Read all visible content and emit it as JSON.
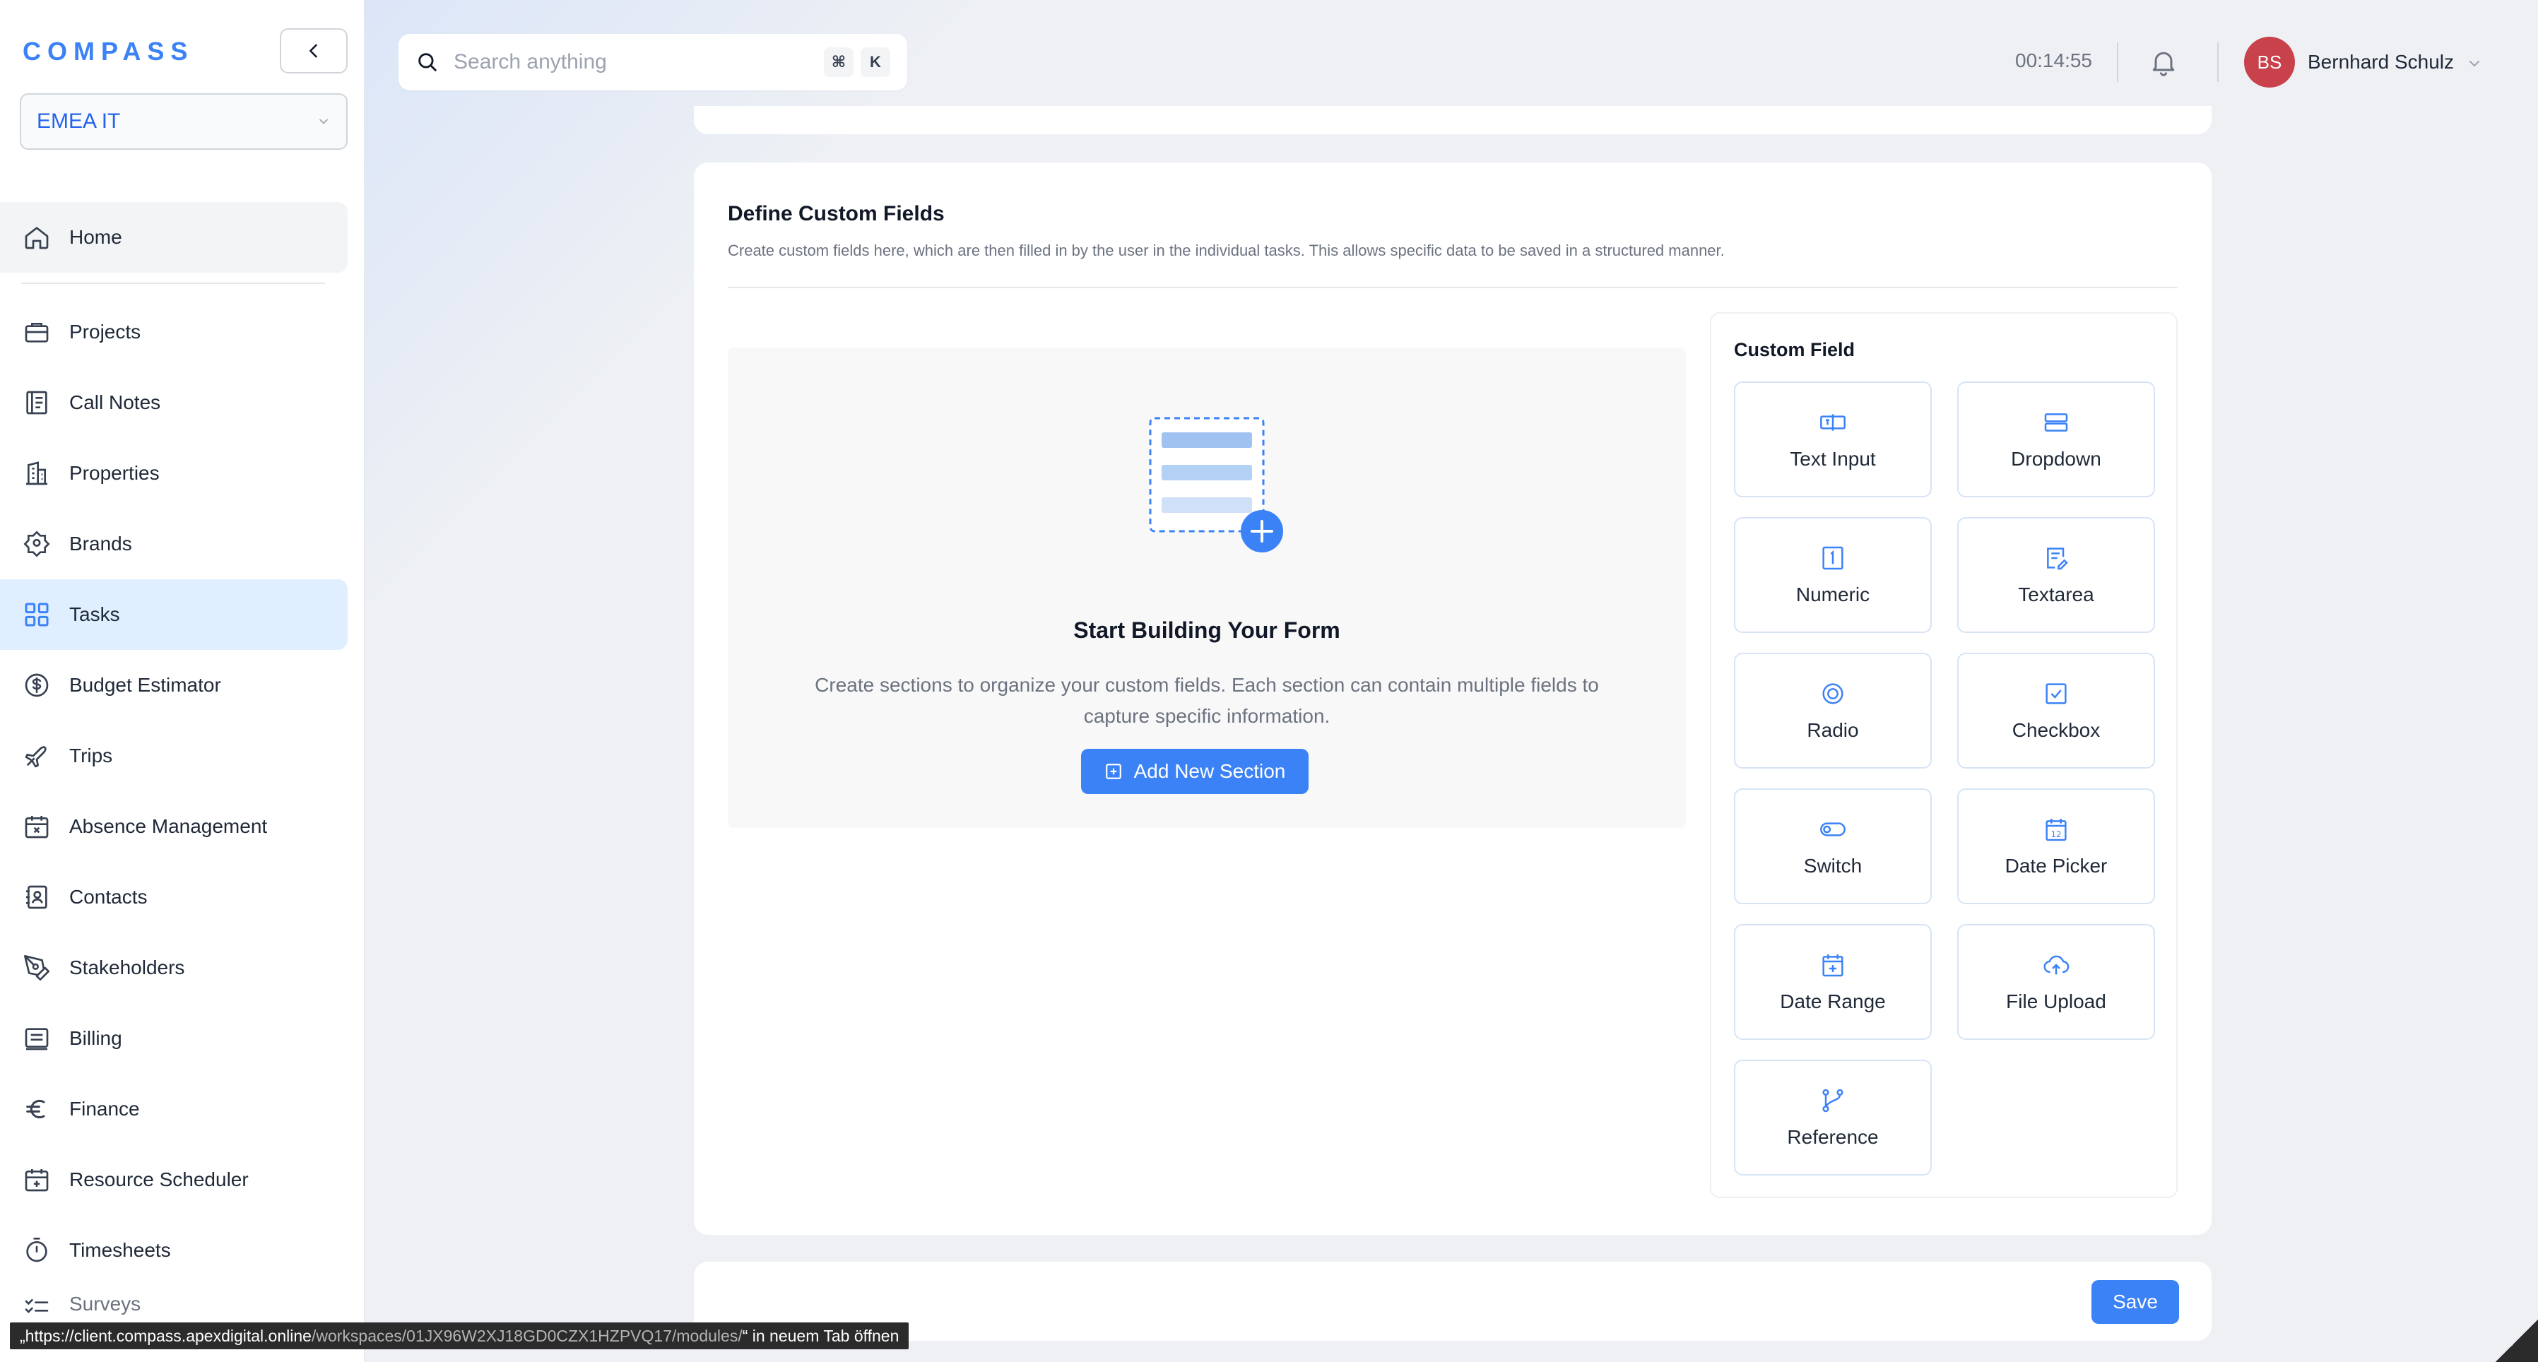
{
  "app": {
    "logo": "COMPASS"
  },
  "sidebar": {
    "org": "EMEA IT",
    "items": [
      {
        "label": "Home"
      },
      {
        "label": "Projects"
      },
      {
        "label": "Call Notes"
      },
      {
        "label": "Properties"
      },
      {
        "label": "Brands"
      },
      {
        "label": "Tasks"
      },
      {
        "label": "Budget Estimator"
      },
      {
        "label": "Trips"
      },
      {
        "label": "Absence Management"
      },
      {
        "label": "Contacts"
      },
      {
        "label": "Stakeholders"
      },
      {
        "label": "Billing"
      },
      {
        "label": "Finance"
      },
      {
        "label": "Resource Scheduler"
      },
      {
        "label": "Timesheets"
      },
      {
        "label": "Surveys"
      }
    ],
    "active": "Tasks"
  },
  "topbar": {
    "search_placeholder": "Search anything",
    "shortcut_cmd": "⌘",
    "shortcut_key": "K",
    "timer": "00:14:55",
    "user_initials": "BS",
    "user_name": "Bernhard Schulz"
  },
  "custom_fields": {
    "title": "Define Custom Fields",
    "description": "Create custom fields here, which are then filled in by the user in the individual tasks. This allows specific data to be saved in a structured manner.",
    "empty_title": "Start Building Your Form",
    "empty_desc": "Create sections to organize your custom fields. Each section can contain multiple fields to capture specific information.",
    "add_section": "Add New Section",
    "palette_title": "Custom Field",
    "fields": [
      {
        "label": "Text Input",
        "icon": "text-input-icon"
      },
      {
        "label": "Dropdown",
        "icon": "dropdown-icon"
      },
      {
        "label": "Numeric",
        "icon": "numeric-icon"
      },
      {
        "label": "Textarea",
        "icon": "textarea-icon"
      },
      {
        "label": "Radio",
        "icon": "radio-icon"
      },
      {
        "label": "Checkbox",
        "icon": "checkbox-icon"
      },
      {
        "label": "Switch",
        "icon": "switch-icon"
      },
      {
        "label": "Date Picker",
        "icon": "date-picker-icon"
      },
      {
        "label": "Date Range",
        "icon": "date-range-icon"
      },
      {
        "label": "File Upload",
        "icon": "file-upload-icon"
      },
      {
        "label": "Reference",
        "icon": "reference-icon"
      }
    ]
  },
  "actions": {
    "save": "Save"
  },
  "status_bar": {
    "prefix": "„https://client.compass.apexdigital.online",
    "path": "/workspaces/01JX96W2XJ18GD0CZX1HZPVQ17/modules/",
    "suffix": "“ in neuem Tab öffnen"
  },
  "colors": {
    "accent": "#3b82f6",
    "active_nav": "#e0efff",
    "avatar": "#c8414b"
  }
}
